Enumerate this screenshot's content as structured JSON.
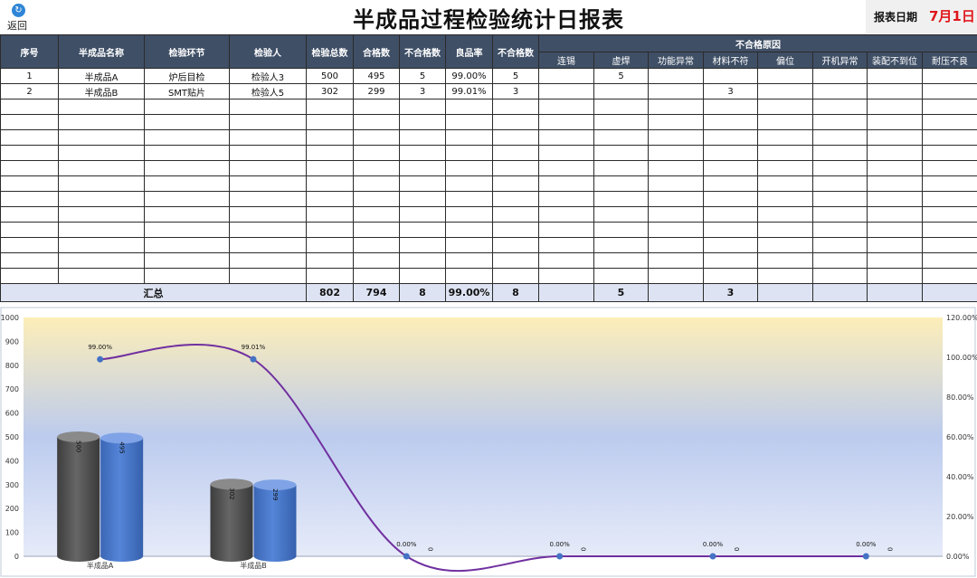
{
  "back": {
    "label": "返回",
    "icon": "refresh-icon"
  },
  "title": "半成品过程检验统计日报表",
  "report_date": {
    "label": "报表日期",
    "value": "7月1日",
    "color": "#e0161a"
  },
  "table": {
    "headers": [
      "序号",
      "半成品名称",
      "检验环节",
      "检验人",
      "检验总数",
      "合格数",
      "不合格数",
      "良品率",
      "不合格数"
    ],
    "reason_header": "不合格原因",
    "reasons": [
      "连锡",
      "虚焊",
      "功能异常",
      "材料不符",
      "偏位",
      "开机异常",
      "装配不到位",
      "耐压不良"
    ],
    "rows": [
      {
        "seq": "1",
        "name": "半成品A",
        "stage": "炉后目检",
        "inspector": "检验人3",
        "total": "500",
        "pass": "495",
        "fail": "5",
        "rate": "99.00%",
        "fail2": "5",
        "reasons": [
          "",
          "5",
          "",
          "",
          "",
          "",
          "",
          ""
        ]
      },
      {
        "seq": "2",
        "name": "半成品B",
        "stage": "SMT贴片",
        "inspector": "检验人5",
        "total": "302",
        "pass": "299",
        "fail": "3",
        "rate": "99.01%",
        "fail2": "3",
        "reasons": [
          "",
          "",
          "",
          "3",
          "",
          "",
          "",
          ""
        ]
      }
    ],
    "empty_rows": 12,
    "summary": {
      "label": "汇总",
      "total": "802",
      "pass": "794",
      "fail": "8",
      "rate": "99.00%",
      "fail2": "8",
      "reasons": [
        "",
        "5",
        "",
        "3",
        "",
        "",
        "",
        ""
      ]
    }
  },
  "chart_data": {
    "type": "bar",
    "categories": [
      "半成品A",
      "半成品B",
      "",
      "",
      "",
      ""
    ],
    "series": [
      {
        "kind": "cylinder",
        "values": [
          500,
          302,
          null,
          null,
          null,
          null
        ],
        "labels": [
          "500",
          "302",
          "",
          "",
          "",
          ""
        ],
        "color": "#555555"
      },
      {
        "kind": "cylinder",
        "values": [
          495,
          299,
          null,
          null,
          null,
          0
        ],
        "labels": [
          "495",
          "299",
          "0",
          "0",
          "0",
          "0"
        ],
        "color": "#4472c4"
      },
      {
        "kind": "line",
        "axis": "right",
        "values": [
          99.0,
          99.01,
          0,
          0,
          0,
          0
        ],
        "labels": [
          "99.00%",
          "99.01%",
          "0.00%",
          "0.00%",
          "0.00%",
          "0.00%"
        ],
        "color": "#7030a0"
      }
    ],
    "left_axis": {
      "ylim": [
        0,
        1000
      ],
      "ticks": [
        "0",
        "100",
        "200",
        "300",
        "400",
        "500",
        "600",
        "700",
        "800",
        "900",
        "1000"
      ]
    },
    "right_axis": {
      "ylim": [
        0,
        120
      ],
      "ticks": [
        "0.00%",
        "20.00%",
        "40.00%",
        "60.00%",
        "80.00%",
        "100.00%",
        "120.00%"
      ]
    },
    "background": {
      "top": "#fdeeb8",
      "middle": "#bccbee",
      "bottom": "#e6ebf9"
    }
  }
}
